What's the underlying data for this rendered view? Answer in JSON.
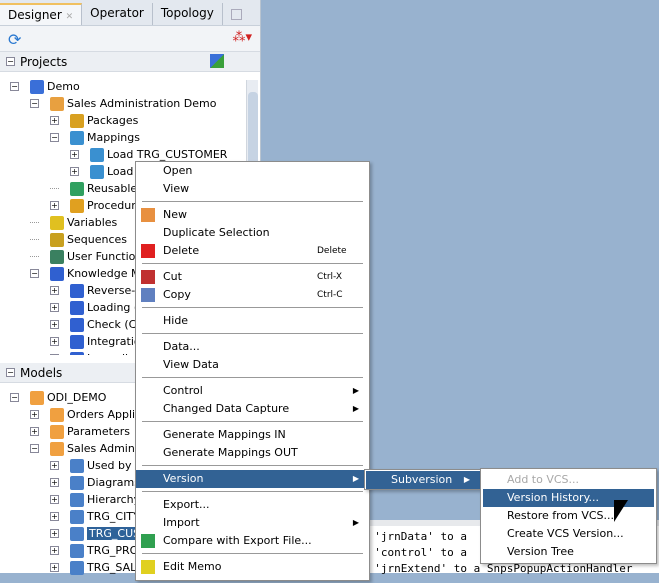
{
  "tabs": [
    "Designer",
    "Operator",
    "Topology"
  ],
  "projects": {
    "title": "Projects",
    "rows": [
      {
        "label": "Demo",
        "level": 0,
        "exp": "-"
      },
      {
        "label": "Sales Administration Demo",
        "level": 1,
        "exp": "-"
      },
      {
        "label": "Packages",
        "level": 2,
        "exp": "+"
      },
      {
        "label": "Mappings",
        "level": 2,
        "exp": "-"
      },
      {
        "label": "Load TRG_CUSTOMER",
        "level": 3,
        "exp": "+"
      },
      {
        "label": "Load",
        "level": 3,
        "exp": "+"
      },
      {
        "label": "Reusable",
        "level": 2,
        "exp": ""
      },
      {
        "label": "Procedur",
        "level": 2,
        "exp": "+"
      },
      {
        "label": "Variables",
        "level": 1,
        "exp": ""
      },
      {
        "label": "Sequences",
        "level": 1,
        "exp": ""
      },
      {
        "label": "User Functio",
        "level": 1,
        "exp": ""
      },
      {
        "label": "Knowledge M",
        "level": 1,
        "exp": "-"
      },
      {
        "label": "Reverse-",
        "level": 2,
        "exp": "+"
      },
      {
        "label": "Loading (",
        "level": 2,
        "exp": "+"
      },
      {
        "label": "Check (C",
        "level": 2,
        "exp": "+"
      },
      {
        "label": "Integratio",
        "level": 2,
        "exp": "+"
      },
      {
        "label": "Journaliz",
        "level": 2,
        "exp": "+"
      }
    ]
  },
  "models": {
    "title": "Models",
    "rows": [
      {
        "label": "ODI_DEMO",
        "level": 0,
        "exp": "-"
      },
      {
        "label": "Orders Appli",
        "level": 1,
        "exp": "+"
      },
      {
        "label": "Parameters",
        "level": 1,
        "exp": "+"
      },
      {
        "label": "Sales Admini",
        "level": 1,
        "exp": "-"
      },
      {
        "label": "Used by",
        "level": 2,
        "exp": "+"
      },
      {
        "label": "Diagrams",
        "level": 2,
        "exp": "+"
      },
      {
        "label": "Hierarchy",
        "level": 2,
        "exp": "+"
      },
      {
        "label": "TRG_CITY",
        "level": 2,
        "exp": "+"
      },
      {
        "label": "TRG_CUS",
        "level": 2,
        "exp": "+",
        "selected": true
      },
      {
        "label": "TRG_PRO",
        "level": 2,
        "exp": "+"
      },
      {
        "label": "TRG_SAL",
        "level": 2,
        "exp": "+"
      }
    ]
  },
  "context_menu": [
    {
      "label": "Open"
    },
    {
      "label": "View"
    },
    {
      "sep": true
    },
    {
      "label": "New",
      "icon": "new-icon"
    },
    {
      "label": "Duplicate Selection"
    },
    {
      "label": "Delete",
      "shortcut": "Delete",
      "icon": "delete-icon"
    },
    {
      "sep": true
    },
    {
      "label": "Cut",
      "shortcut": "Ctrl-X",
      "icon": "cut-icon"
    },
    {
      "label": "Copy",
      "shortcut": "Ctrl-C",
      "icon": "copy-icon"
    },
    {
      "sep": true
    },
    {
      "label": "Hide"
    },
    {
      "sep": true
    },
    {
      "label": "Data..."
    },
    {
      "label": "View Data"
    },
    {
      "sep": true
    },
    {
      "label": "Control",
      "submenu": true
    },
    {
      "label": "Changed Data Capture",
      "submenu": true
    },
    {
      "sep": true
    },
    {
      "label": "Generate Mappings IN"
    },
    {
      "label": "Generate Mappings OUT"
    },
    {
      "sep": true
    },
    {
      "label": "Version",
      "submenu": true,
      "highlighted": true
    },
    {
      "sep": true
    },
    {
      "label": "Export..."
    },
    {
      "label": "Import",
      "submenu": true
    },
    {
      "label": "Compare with Export File...",
      "icon": "compare-icon"
    },
    {
      "sep": true
    },
    {
      "label": "Edit Memo",
      "icon": "memo-icon"
    }
  ],
  "version_submenu": [
    {
      "label": "Subversion",
      "submenu": true,
      "highlighted": true
    }
  ],
  "subversion_submenu": [
    {
      "label": "Add to VCS...",
      "disabled": true
    },
    {
      "label": "Version History...",
      "highlighted": true
    },
    {
      "label": "Restore from VCS..."
    },
    {
      "label": "Create VCS Version..."
    },
    {
      "label": "Version Tree"
    }
  ],
  "log_lines": [
    "d 'jrnData' to a",
    "d 'control' to a",
    "d 'jrnExtend' to a SnpsPopupActionHandler"
  ]
}
